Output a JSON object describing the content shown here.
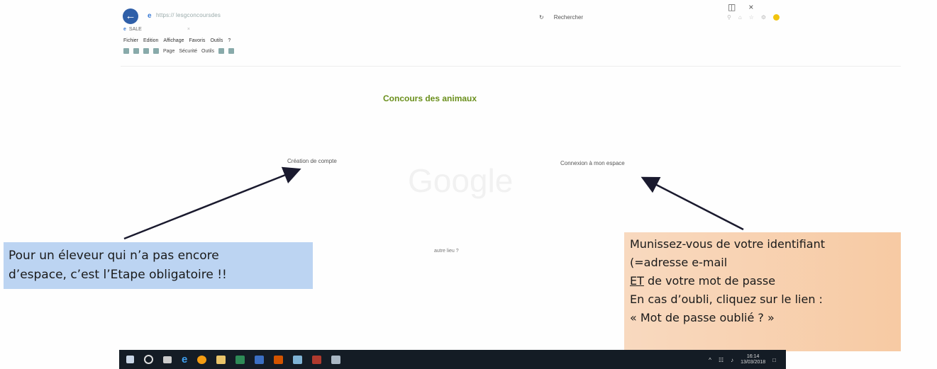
{
  "browser": {
    "address": "https://           lesgconcoursdes   ",
    "tab_label": "SALE",
    "search_label": "Rechercher",
    "menu": [
      "Fichier",
      "Edition",
      "Affichage",
      "Favoris",
      "Outils",
      "?"
    ],
    "commands": [
      "Page",
      "Sécurité",
      "Outils"
    ]
  },
  "page": {
    "title": "Concours des animaux",
    "create_account": "Création de compte",
    "connect": "Connexion à mon espace",
    "watermark": "Google",
    "footer_link": "autre lieu ?"
  },
  "notes": {
    "left": [
      "Pour un éleveur qui n’a pas encore",
      "d’espace,  c’est l’Etape obligatoire !!"
    ],
    "right": {
      "line1": "Munissez-vous de votre identifiant",
      "line2": "(=adresse e-mail",
      "line3_et": "ET",
      "line3_rest": " de votre mot de passe",
      "line4": "En cas d’oubli, cliquez sur le lien :",
      "line5": "« Mot de passe oublié ? »"
    }
  },
  "taskbar": {
    "time": "16:14",
    "date": "13/03/2018"
  },
  "colors": {
    "title": "#6a8f1c",
    "note_left_bg": "#bcd4f2",
    "note_right_bg": "#f7caa3",
    "taskbar_bg": "#141c25"
  }
}
